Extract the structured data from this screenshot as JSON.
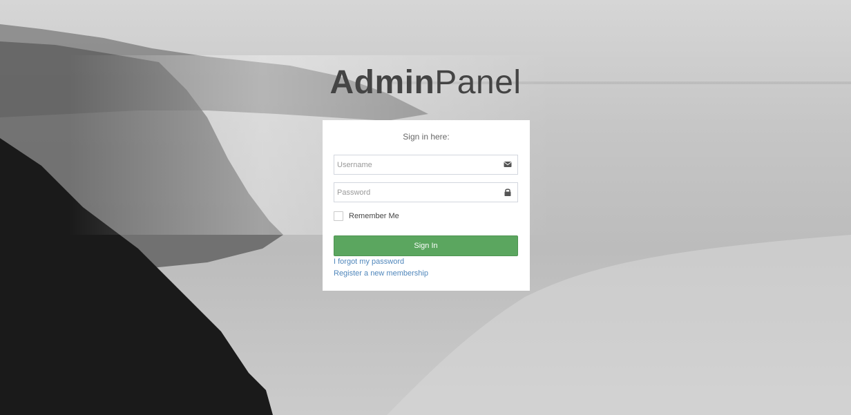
{
  "logo": {
    "bold": "Admin",
    "light": "Panel"
  },
  "login": {
    "message": "Sign in here:",
    "username": {
      "placeholder": "Username",
      "value": "",
      "icon": "envelope-icon"
    },
    "password": {
      "placeholder": "Password",
      "value": "",
      "icon": "lock-icon"
    },
    "remember_label": "Remember Me",
    "remember_checked": false,
    "submit_label": "Sign In",
    "forgot_label": "I forgot my password",
    "register_label": "Register a new membership"
  },
  "colors": {
    "button": "#5ba65f",
    "link": "#4f86bb",
    "logo": "#444444"
  }
}
